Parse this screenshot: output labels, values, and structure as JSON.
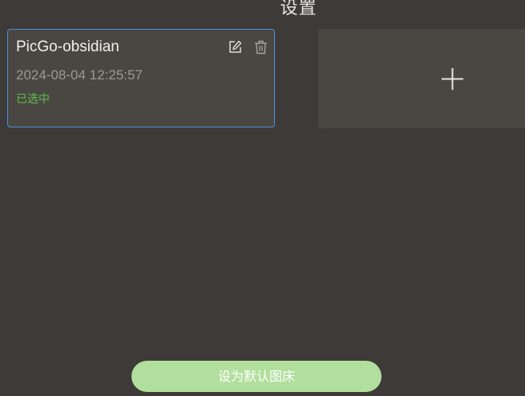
{
  "header": {
    "title": "设置"
  },
  "config_card": {
    "name": "PicGo-obsidian",
    "date": "2024-08-04 12:25:57",
    "status": "已选中",
    "edit_icon": "edit-icon",
    "delete_icon": "trash-icon"
  },
  "add_card": {
    "icon": "plus-icon"
  },
  "footer": {
    "default_button_label": "设为默认图床"
  },
  "colors": {
    "background": "#3e3a37",
    "card": "#4a4743",
    "selected_border": "#4a90d9",
    "status_green": "#5fbf4a",
    "button_green": "#b1df9d"
  }
}
